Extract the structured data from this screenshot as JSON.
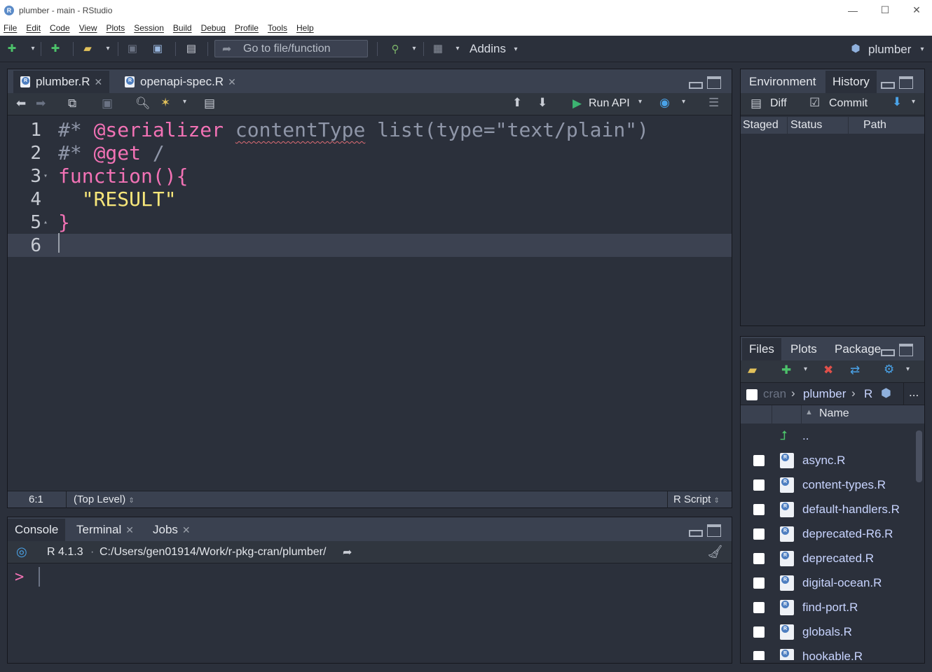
{
  "window": {
    "title": "plumber - main - RStudio",
    "minimize": "—",
    "maximize": "☐",
    "close": "✕"
  },
  "menu": [
    "File",
    "Edit",
    "Code",
    "View",
    "Plots",
    "Session",
    "Build",
    "Debug",
    "Profile",
    "Tools",
    "Help"
  ],
  "toolbar": {
    "goto_placeholder": "Go to file/function",
    "addins": "Addins",
    "project": "plumber"
  },
  "editor": {
    "tabs": [
      {
        "label": "plumber.R",
        "active": true
      },
      {
        "label": "openapi-spec.R",
        "active": false
      }
    ],
    "run_api": "Run API",
    "lines": [
      {
        "num": "1",
        "fold": "",
        "parts": [
          {
            "t": "#* ",
            "c": "c-com"
          },
          {
            "t": "@serializer",
            "c": "c-kw"
          },
          {
            "t": " ",
            "c": ""
          },
          {
            "t": "contentType",
            "c": "c-ident squig"
          },
          {
            "t": " list(type=\"text/plain\")",
            "c": "c-com"
          }
        ]
      },
      {
        "num": "2",
        "fold": "",
        "parts": [
          {
            "t": "#* ",
            "c": "c-com"
          },
          {
            "t": "@get",
            "c": "c-kw"
          },
          {
            "t": " /",
            "c": "c-com"
          }
        ]
      },
      {
        "num": "3",
        "fold": "▾",
        "parts": [
          {
            "t": "function(){",
            "c": "c-kw"
          }
        ]
      },
      {
        "num": "4",
        "fold": "",
        "parts": [
          {
            "t": "  ",
            "c": ""
          },
          {
            "t": "\"RESULT\"",
            "c": "c-str"
          }
        ]
      },
      {
        "num": "5",
        "fold": "▴",
        "parts": [
          {
            "t": "}",
            "c": "c-kw"
          }
        ]
      },
      {
        "num": "6",
        "fold": "",
        "parts": []
      }
    ],
    "status": {
      "position": "6:1",
      "scope": "(Top Level)",
      "filetype": "R Script"
    }
  },
  "console": {
    "tabs": [
      {
        "label": "Console",
        "active": true,
        "close": false
      },
      {
        "label": "Terminal",
        "active": false,
        "close": true
      },
      {
        "label": "Jobs",
        "active": false,
        "close": true
      }
    ],
    "r_version": "R 4.1.3",
    "separator": "·",
    "path": "C:/Users/gen01914/Work/r-pkg-cran/plumber/",
    "prompt": ">"
  },
  "env": {
    "tabs": [
      {
        "label": "Environment",
        "active": false
      },
      {
        "label": "History",
        "active": true
      }
    ],
    "diff": "Diff",
    "commit": "Commit",
    "columns": [
      "Staged",
      "Status",
      "Path"
    ]
  },
  "files": {
    "tabs": [
      {
        "label": "Files",
        "active": true
      },
      {
        "label": "Plots",
        "active": false
      },
      {
        "label": "Package",
        "active": false
      }
    ],
    "breadcrumb": [
      "cran",
      "plumber",
      "R"
    ],
    "more": "...",
    "name_col": "Name",
    "up": "..",
    "items": [
      "async.R",
      "content-types.R",
      "default-handlers.R",
      "deprecated-R6.R",
      "deprecated.R",
      "digital-ocean.R",
      "find-port.R",
      "globals.R",
      "hookable.R"
    ]
  },
  "colors": {
    "background": "#2b303b",
    "panel": "#3a4150",
    "keyword": "#f272b5",
    "string": "#f7e67a",
    "comment": "#8f96a8",
    "accent": "#4aa3e8"
  }
}
